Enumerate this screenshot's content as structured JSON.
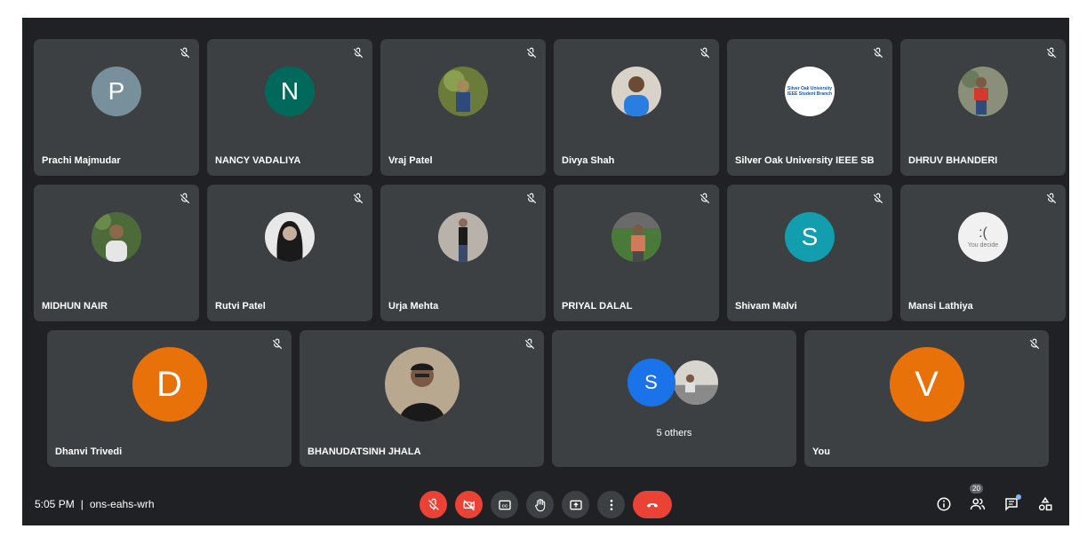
{
  "meeting": {
    "time": "5:05 PM",
    "separator": "|",
    "code": "ons-eahs-wrh"
  },
  "participants": {
    "row1": [
      {
        "name": "Prachi Majmudar",
        "avatar_type": "initial",
        "initial": "P",
        "color": "#78909c"
      },
      {
        "name": "NANCY VADALIYA",
        "avatar_type": "initial",
        "initial": "N",
        "color": "#00695c"
      },
      {
        "name": "Vraj Patel",
        "avatar_type": "photo",
        "photo_colors": [
          "#6b7b3a",
          "#2e4a7a",
          "#a28a5a"
        ]
      },
      {
        "name": "Divya Shah",
        "avatar_type": "photo",
        "photo_colors": [
          "#d8d2c8",
          "#2a7de1",
          "#6b4b33"
        ]
      },
      {
        "name": "Silver Oak University IEEE SB",
        "avatar_type": "logo",
        "logo_lines": [
          "Silver Oak University",
          "IEEE Student Branch"
        ]
      },
      {
        "name": "DHRUV BHANDERI",
        "avatar_type": "photo",
        "photo_colors": [
          "#8a8f7a",
          "#d33a2f",
          "#2f4b7a"
        ]
      }
    ],
    "row2": [
      {
        "name": "MIDHUN NAIR",
        "avatar_type": "photo",
        "photo_colors": [
          "#4d6b3a",
          "#e6e6e6",
          "#8a6a4a"
        ]
      },
      {
        "name": "Rutvi Patel",
        "avatar_type": "photo",
        "photo_colors": [
          "#e8e8e8",
          "#1a1a1a",
          "#9a9a9a"
        ]
      },
      {
        "name": "Urja Mehta",
        "avatar_type": "photo",
        "photo_colors": [
          "#b8b2aa",
          "#1c1c1c",
          "#8a6a5a"
        ]
      },
      {
        "name": "PRIYAL DALAL",
        "avatar_type": "photo",
        "photo_colors": [
          "#4a7a3a",
          "#d07a5a",
          "#4a4a4a"
        ]
      },
      {
        "name": "Shivam Malvi",
        "avatar_type": "initial",
        "initial": "S",
        "color": "#129eaf"
      },
      {
        "name": "Mansi Lathiya",
        "avatar_type": "decide",
        "face": ":(",
        "caption": "You decide"
      }
    ],
    "row3": [
      {
        "name": "Dhanvi Trivedi",
        "avatar_type": "initial",
        "initial": "D",
        "color": "#e8710a"
      },
      {
        "name": "BHANUDATSINH JHALA",
        "avatar_type": "photo",
        "photo_colors": [
          "#b8a890",
          "#1a1a1a",
          "#7a5a44"
        ]
      },
      {
        "name": "",
        "avatar_type": "others",
        "initial": "S",
        "label": "5 others"
      },
      {
        "name": "You",
        "avatar_type": "initial",
        "initial": "V",
        "color": "#e8710a"
      }
    ]
  },
  "controls": {
    "mic": "microphone-muted",
    "camera": "camera-off",
    "captions": "CC",
    "raise_hand": "hand",
    "present": "present-screen",
    "more": "more-options",
    "leave": "end-call"
  },
  "right_controls": {
    "people_count": "20"
  },
  "colors": {
    "background": "#202124",
    "tile": "#3c4043",
    "danger": "#ea4335",
    "accent": "#8ab4f8"
  }
}
